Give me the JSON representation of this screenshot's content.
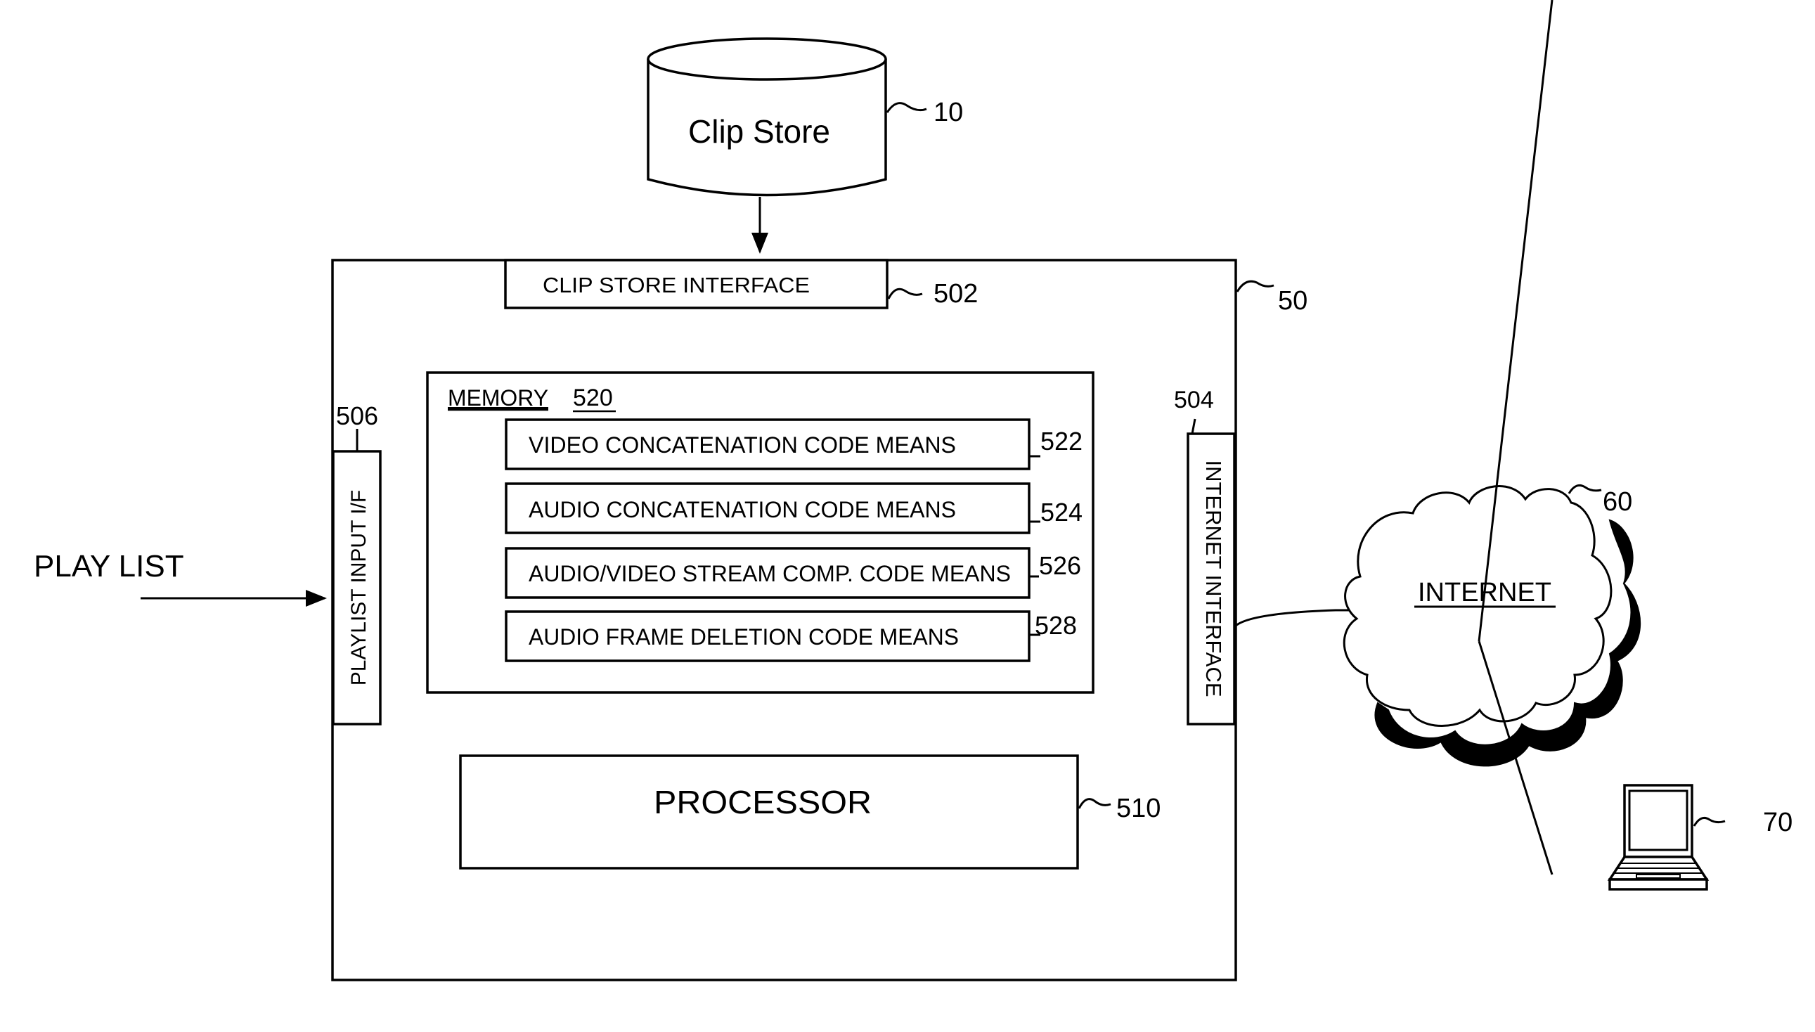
{
  "figure": {
    "clip_store": {
      "label": "Clip Store",
      "ref": "10"
    },
    "server": {
      "ref": "50"
    },
    "clip_store_interface": {
      "label": "CLIP STORE INTERFACE",
      "ref": "502"
    },
    "memory": {
      "label": "MEMORY",
      "ref": "520",
      "modules": [
        {
          "label": "VIDEO CONCATENATION CODE MEANS",
          "ref": "522"
        },
        {
          "label": "AUDIO CONCATENATION CODE MEANS",
          "ref": "524"
        },
        {
          "label": "AUDIO/VIDEO STREAM COMP. CODE MEANS",
          "ref": "526"
        },
        {
          "label": "AUDIO FRAME DELETION CODE MEANS",
          "ref": "528"
        }
      ]
    },
    "playlist_input": {
      "label": "PLAYLIST INPUT I/F",
      "ref": "506"
    },
    "internet_interface": {
      "label": "INTERNET INTERFACE",
      "ref": "504"
    },
    "processor": {
      "label": "PROCESSOR",
      "ref": "510"
    },
    "play_list": {
      "label": "PLAY LIST"
    },
    "internet": {
      "label": "INTERNET",
      "ref": "60"
    },
    "client": {
      "ref": "70"
    }
  }
}
